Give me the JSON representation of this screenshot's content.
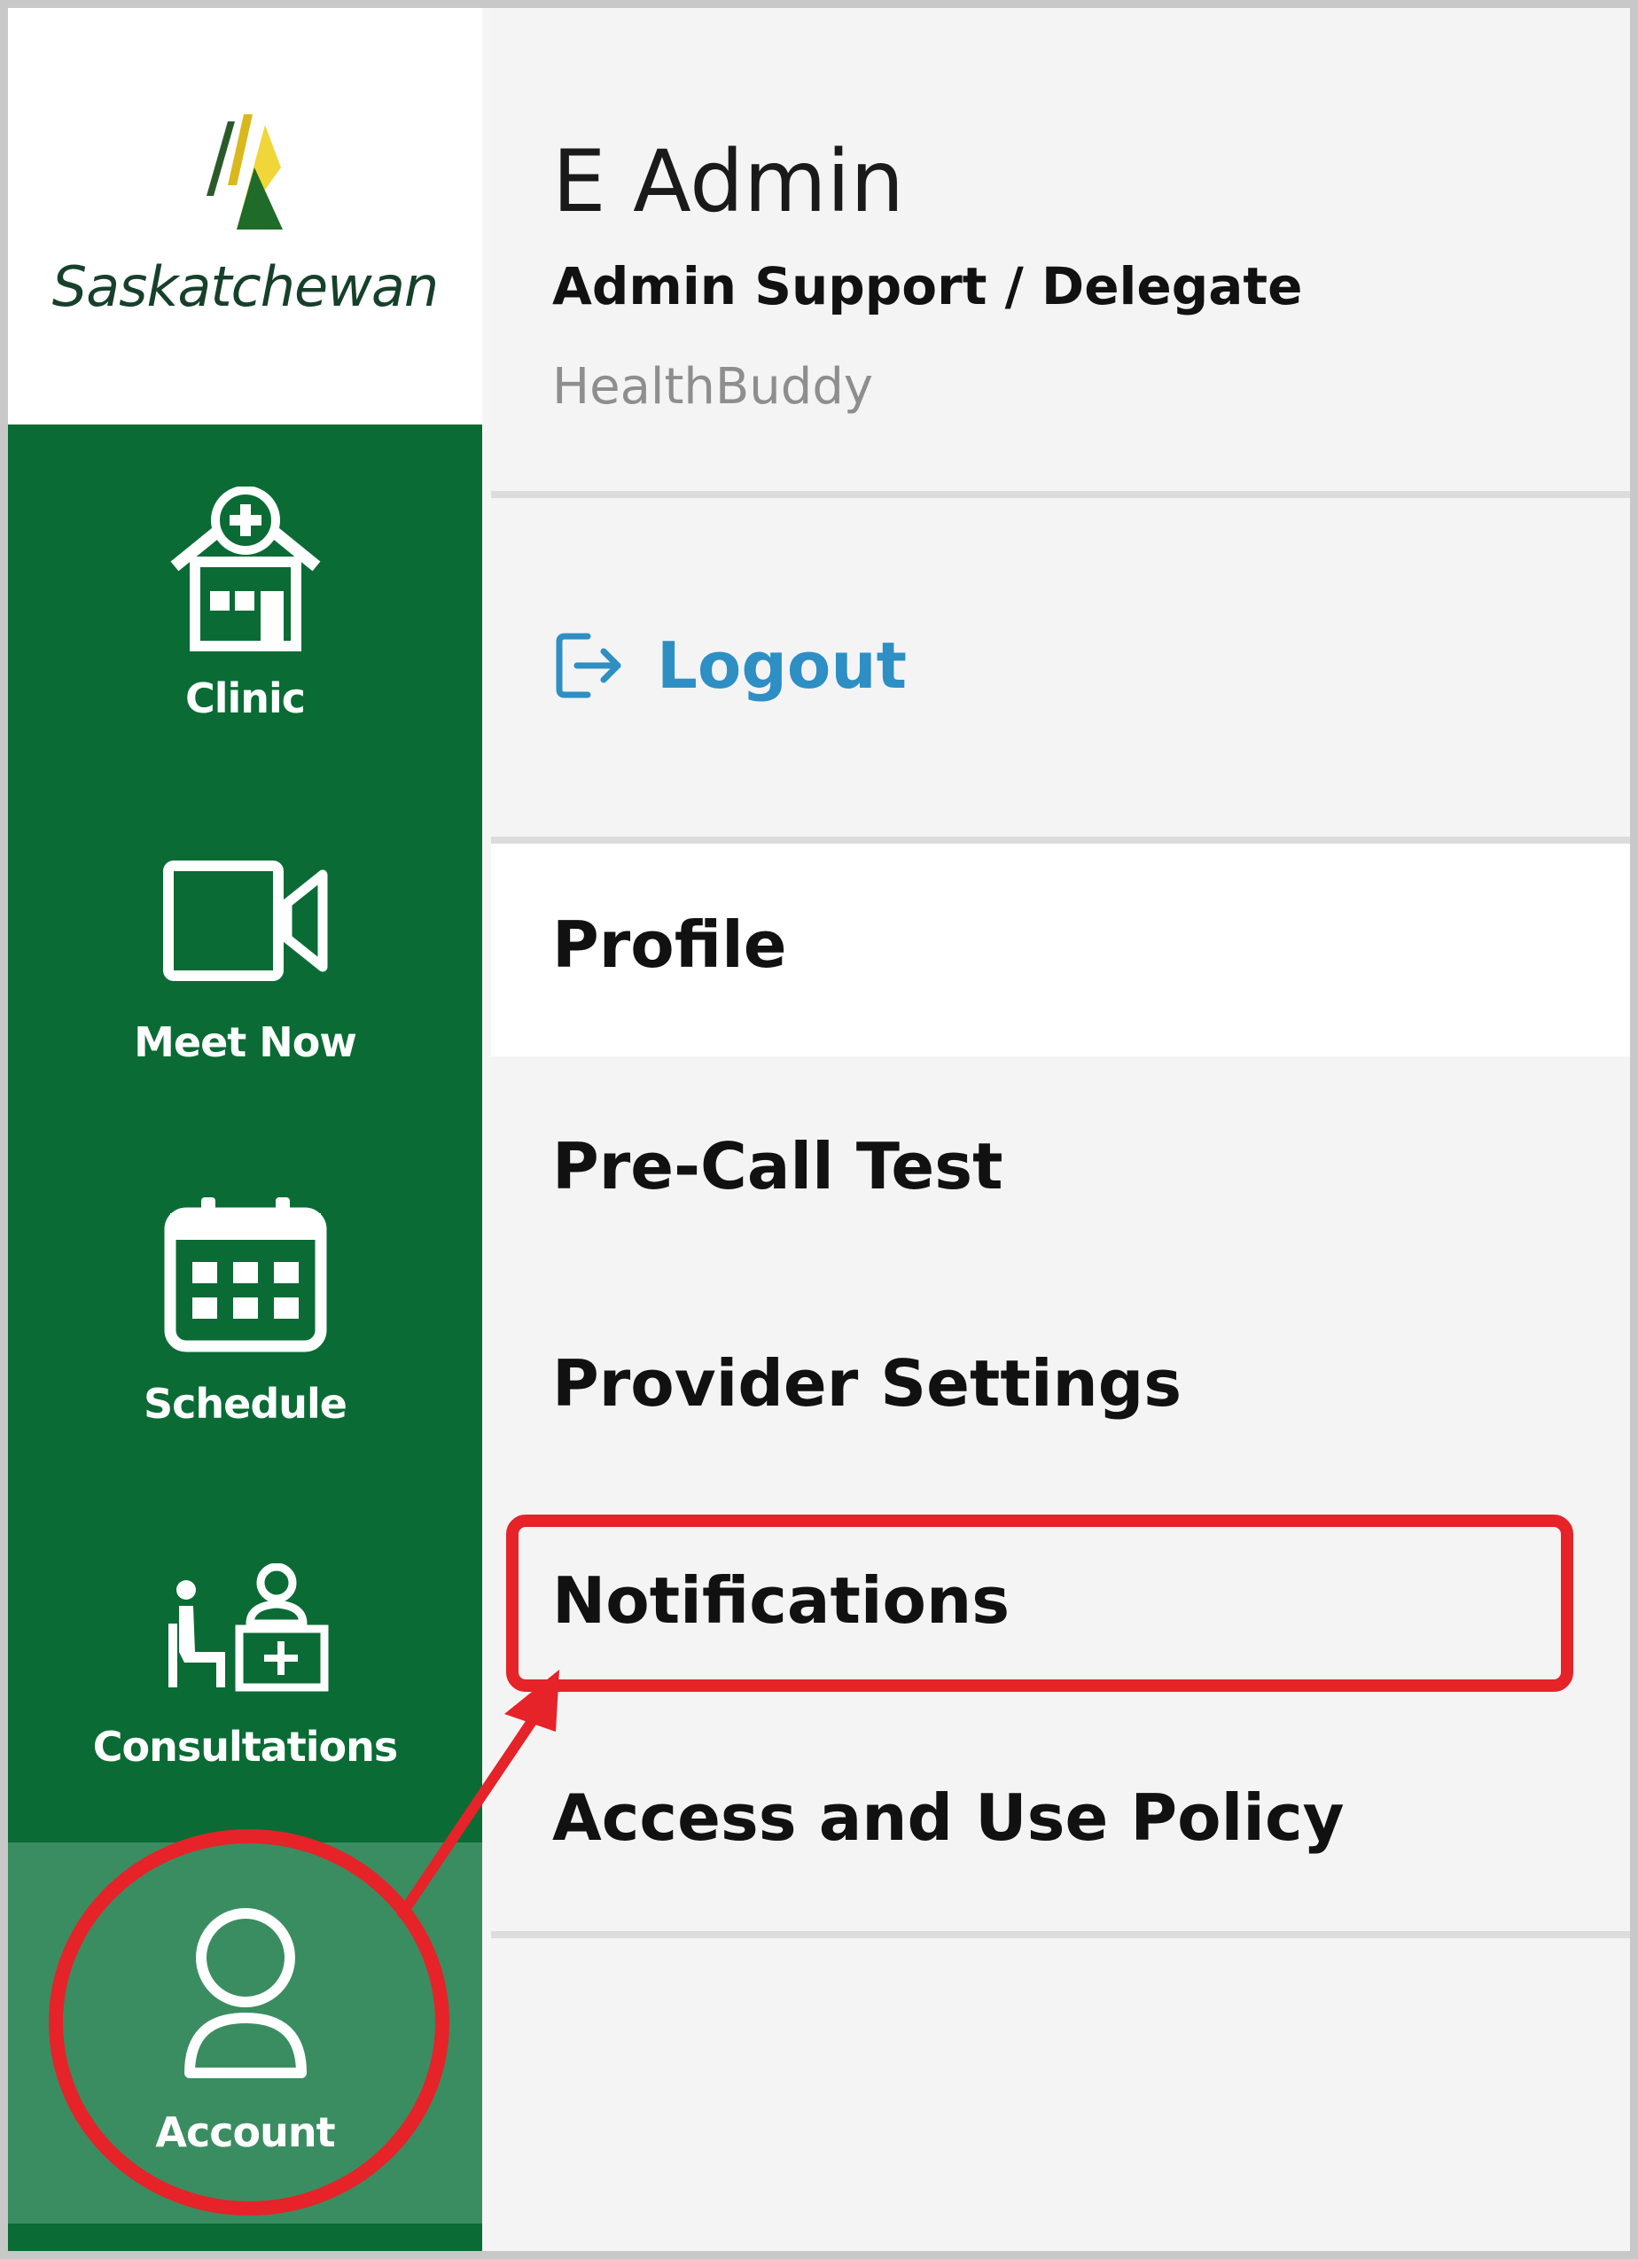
{
  "brand": {
    "logo_text": "Saskatchewan"
  },
  "sidebar": {
    "items": [
      {
        "label": "Clinic",
        "icon": "clinic-icon"
      },
      {
        "label": "Meet Now",
        "icon": "video-camera-icon"
      },
      {
        "label": "Schedule",
        "icon": "calendar-icon"
      },
      {
        "label": "Consultations",
        "icon": "consultation-icon"
      },
      {
        "label": "Account",
        "icon": "user-icon",
        "active": true
      }
    ]
  },
  "account": {
    "name": "E Admin",
    "role": "Admin Support / Delegate",
    "organization": "HealthBuddy"
  },
  "logout": {
    "label": "Logout",
    "icon": "logout-icon"
  },
  "menu": {
    "items": [
      {
        "label": "Profile"
      },
      {
        "label": "Pre-Call Test"
      },
      {
        "label": "Provider Settings"
      },
      {
        "label": "Notifications"
      },
      {
        "label": "Access and Use Policy"
      }
    ]
  },
  "colors": {
    "sidebar": "#0a6b35",
    "sidebar_active": "#3a8d61",
    "link": "#2d8fc4",
    "annotation": "#e52329"
  }
}
